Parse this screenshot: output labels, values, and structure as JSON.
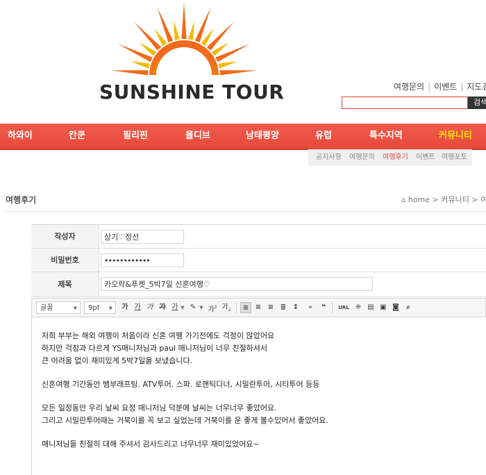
{
  "logo": {
    "text": "SUNSHINE TOUR",
    "sun_color": "#f26a1b",
    "ray_color": "#f5b800"
  },
  "top_links": [
    "여행문의",
    "이벤트",
    "지도검색"
  ],
  "search": {
    "button_label": "검색",
    "value": ""
  },
  "nav": {
    "items": [
      "하와이",
      "칸쿤",
      "필리핀",
      "몰디브",
      "남태평양",
      "유럽",
      "특수지역",
      "커뮤니티"
    ],
    "active": "커뮤니티",
    "bg_color": "#e8473a",
    "active_color": "#ffe400"
  },
  "subnav": {
    "items": [
      "공지사항",
      "여행문의",
      "여행후기",
      "이벤트",
      "여행포토"
    ],
    "active": "여행후기"
  },
  "page": {
    "title": "여행후기",
    "breadcrumb": "home > 커뮤니티 > 여행후기"
  },
  "form": {
    "author_label": "작성자",
    "author_value": "상기♡정선",
    "password_label": "비밀번호",
    "password_value": "••••••••••••",
    "subject_label": "제목",
    "subject_value": "카오락&푸켓_5박7일 신혼여행♡"
  },
  "toolbar": {
    "font": "글꼴",
    "size": "9pt",
    "bold": "가",
    "underline": "가",
    "italic": "가",
    "strike": "가",
    "font_color": "가",
    "superscript": "가",
    "subscript": "가",
    "quote": "❝",
    "url": "URL"
  },
  "editor": {
    "lines": [
      "저희 부부는 해외 여행이 처음이라 신혼 여행 가기전에도 걱정이 많았어요",
      "하지만 걱정과 다르게 YS매니저님과 paul 매니저님이 너무 친절하셔서",
      "큰 어려움 없이 재미있게 5박7일을 보냈습니다.",
      "신혼여행 기간동안 뱀부래프팅. ATV투어. 스파. 로맨틱디너, 시밀란투어, 시티투어 등등",
      "모든 일정동안 우리 날씨 요정 매니저님 덕분에 날씨는 너무너무 좋았어요.",
      "그리고 시밀란투어때는 거북이를 꼭 보고 싶었는데 거북이를 운 좋게 볼수있어서 좋았어요.",
      "매니저님들 친절히 대해 주셔서 감사드리고 너무너무 재미있었어요~"
    ]
  }
}
